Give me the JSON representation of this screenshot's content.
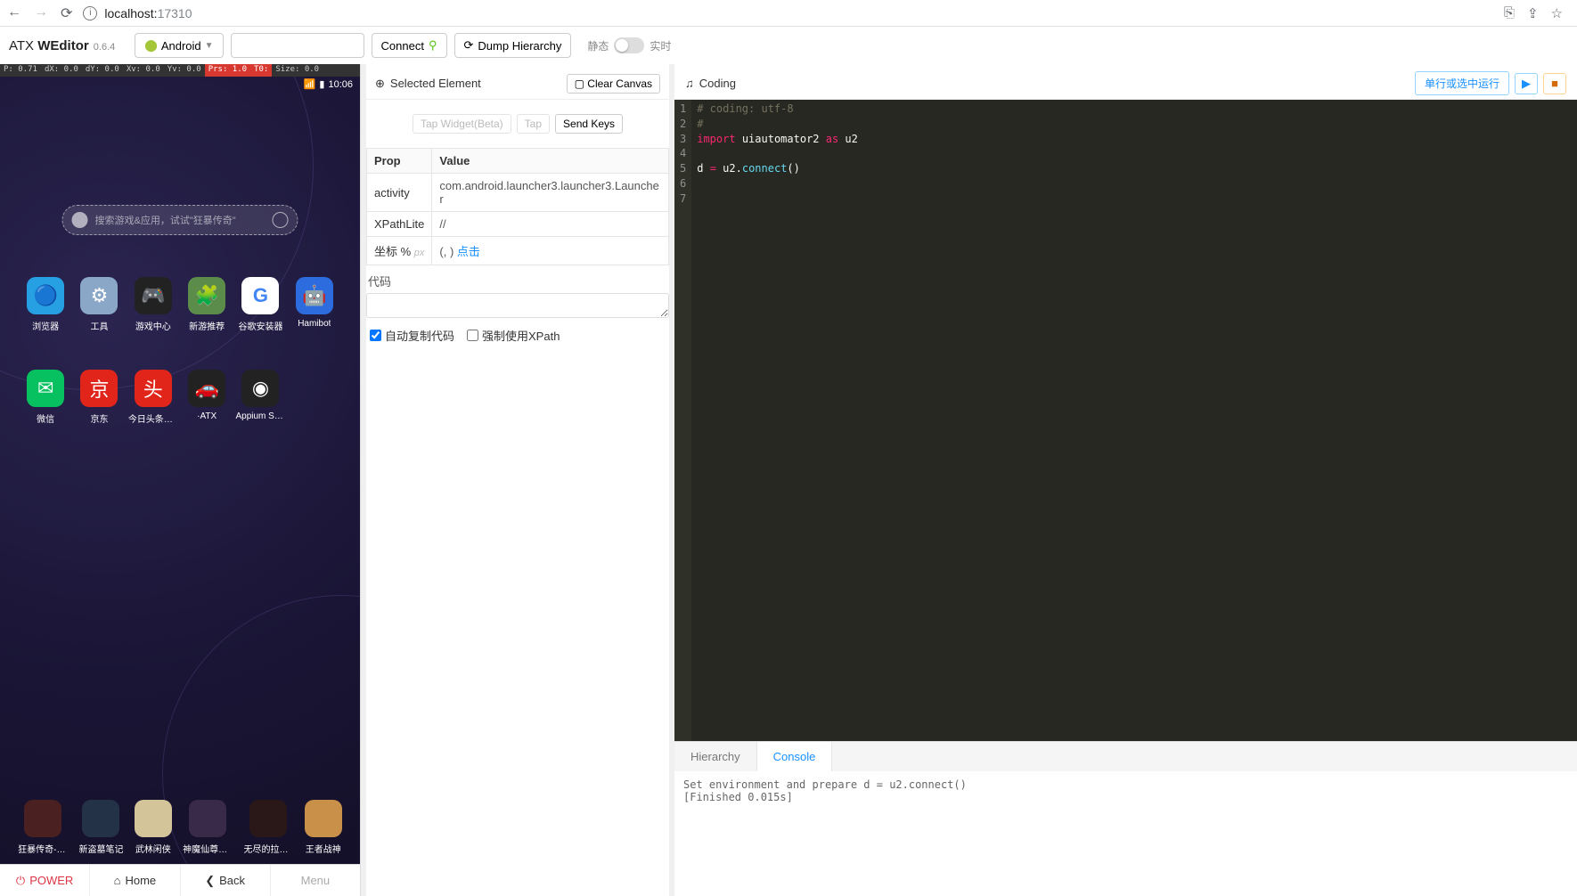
{
  "browser": {
    "url_host": "localhost:",
    "url_port": "17310"
  },
  "toolbar": {
    "brand1": "ATX ",
    "brand2": "WEditor",
    "version": " 0.6.4",
    "platform": "Android",
    "connect": "Connect",
    "dump": "Dump Hierarchy",
    "static": "静态",
    "live": "实时"
  },
  "stats": {
    "p": "P: 0.71",
    "dx": "dX: 0.0",
    "dy": "dY: 0.0",
    "xv": "Xv: 0.0",
    "yv": "Yv: 0.0",
    "prs": "Prs: 1.0",
    "t0": "T0:",
    "size": "Size: 0.0"
  },
  "phone": {
    "time": "10:06",
    "search_placeholder": "搜索游戏&应用，试试\"狂暴传奇\"",
    "apps_row1": [
      {
        "name": "浏览器",
        "color": "#26a0e2",
        "glyph": "🔵"
      },
      {
        "name": "工具",
        "color": "#8aa7c7",
        "glyph": "⚙"
      },
      {
        "name": "游戏中心",
        "color": "#222",
        "glyph": "🎮"
      },
      {
        "name": "新游推荐",
        "color": "#5c8c4a",
        "glyph": "🧩"
      },
      {
        "name": "谷歌安装器",
        "color": "#fff",
        "glyph": "G"
      },
      {
        "name": "Hamibot",
        "color": "#2d6cdf",
        "glyph": "🤖"
      }
    ],
    "apps_row2": [
      {
        "name": "微信",
        "color": "#07c160",
        "glyph": "✉"
      },
      {
        "name": "京东",
        "color": "#e1251b",
        "glyph": "京"
      },
      {
        "name": "今日头条极速...",
        "color": "#e1251b",
        "glyph": "头"
      },
      {
        "name": "·ATX",
        "color": "#222",
        "glyph": "🚗"
      },
      {
        "name": "Appium Settings",
        "color": "#222",
        "glyph": "◉"
      }
    ],
    "dock": [
      {
        "name": "狂暴传奇-铁...",
        "color": "#4a2020"
      },
      {
        "name": "新盗墓笔记",
        "color": "#243248"
      },
      {
        "name": "武林闲侠",
        "color": "#d4c49a"
      },
      {
        "name": "神魔仙尊（全...",
        "color": "#3a2a4a"
      },
      {
        "name": "无尽的拉格朗...",
        "color": "#2a1818"
      },
      {
        "name": "王者战神",
        "color": "#c89048"
      }
    ],
    "nav": {
      "power": "POWER",
      "home": "Home",
      "back": "Back",
      "menu": "Menu"
    }
  },
  "mid": {
    "title": "Selected Element",
    "clear": "Clear Canvas",
    "tap_widget": "Tap Widget(Beta)",
    "tap": "Tap",
    "send_keys": "Send Keys",
    "th_prop": "Prop",
    "th_value": "Value",
    "rows": {
      "activity_k": "activity",
      "activity_v": "com.android.launcher3.launcher3.Launcher",
      "xpath_k": "XPathLite",
      "xpath_v": "//",
      "coord_k": "坐标 %",
      "coord_px": "px",
      "coord_v1": "(, )",
      "coord_click": "点击"
    },
    "code_label": "代码",
    "chk_auto": "自动复制代码",
    "chk_xpath": "强制使用XPath"
  },
  "right": {
    "title": "Coding",
    "run_btn": "单行或选中运行",
    "code_lines": [
      "# coding: utf-8",
      "#",
      "import uiautomator2 as u2",
      "",
      "d = u2.connect()",
      "",
      ""
    ],
    "tab_hierarchy": "Hierarchy",
    "tab_console": "Console",
    "console": "Set environment and prepare d = u2.connect()\n[Finished 0.015s]"
  }
}
